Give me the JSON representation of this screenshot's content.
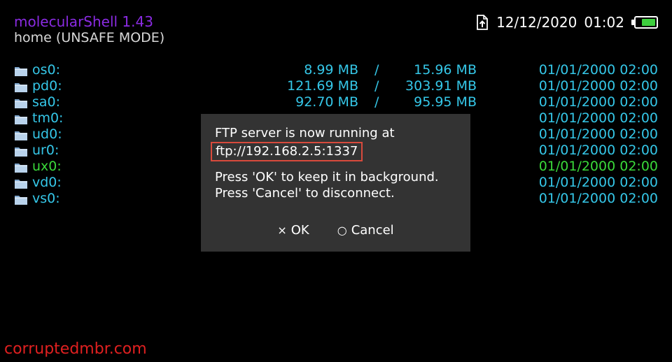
{
  "header": {
    "app_title": "molecularShell 1.43",
    "path": "home (UNSAFE MODE)"
  },
  "status": {
    "ftp_icon": "upload-file-icon",
    "date": "12/12/2020",
    "time": "01:02",
    "battery_level": 0.75,
    "battery_icon": "battery-icon"
  },
  "colors": {
    "title": "#8a2be2",
    "list_text": "#35c7e8",
    "mounted_text": "#3ad93a",
    "dialog_bg": "#333333",
    "highlight_border": "#d84a3c",
    "watermark": "#e02020"
  },
  "devices": [
    {
      "name": "os0:",
      "used": "8.99 MB",
      "sep": "/",
      "total": "15.96 MB",
      "date": "01/01/2000 02:00"
    },
    {
      "name": "pd0:",
      "used": "121.69 MB",
      "sep": "/",
      "total": "303.91 MB",
      "date": "01/01/2000 02:00"
    },
    {
      "name": "sa0:",
      "used": "92.70 MB",
      "sep": "/",
      "total": "95.95 MB",
      "date": "01/01/2000 02:00"
    },
    {
      "name": "tm0:",
      "used": "",
      "sep": "",
      "total": "",
      "date": "01/01/2000 02:00"
    },
    {
      "name": "ud0:",
      "used": "",
      "sep": "",
      "total": "",
      "date": "01/01/2000 02:00"
    },
    {
      "name": "ur0:",
      "used": "",
      "sep": "",
      "total": "",
      "date": "01/01/2000 02:00"
    },
    {
      "name": "ux0:",
      "used": "",
      "sep": "",
      "total": "",
      "date": "01/01/2000 02:00"
    },
    {
      "name": "vd0:",
      "used": "",
      "sep": "",
      "total": "",
      "date": "01/01/2000 02:00"
    },
    {
      "name": "vs0:",
      "used": "",
      "sep": "",
      "total": "",
      "date": "01/01/2000 02:00"
    }
  ],
  "dialog": {
    "line1": "FTP server is now running at",
    "url": "ftp://192.168.2.5:1337",
    "line3": "Press 'OK' to keep it in background.",
    "line4": "Press 'Cancel' to disconnect.",
    "ok_glyph": "×",
    "ok_label": "OK",
    "cancel_glyph": "○",
    "cancel_label": "Cancel"
  },
  "watermark": "corruptedmbr.com"
}
